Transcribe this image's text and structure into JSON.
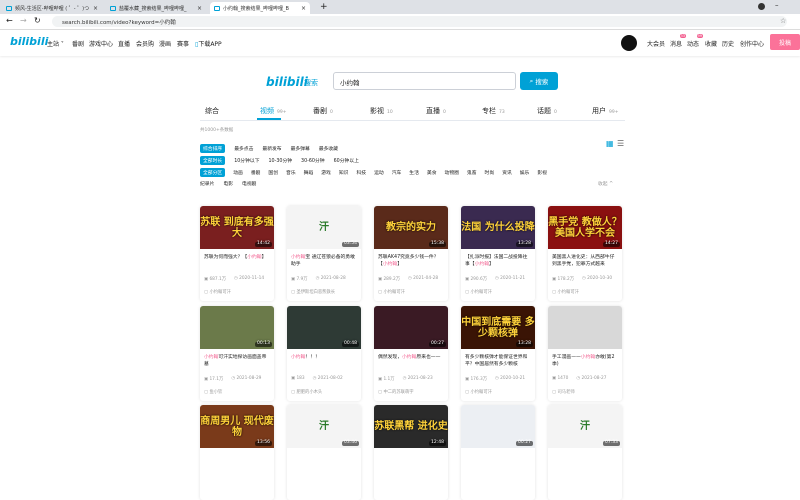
{
  "browser": {
    "tabs": [
      {
        "title": "频风-生活区-哔哩哔哩 ( ゜- ゜)つ"
      },
      {
        "title": "盐覆水藏_搜索结果_哔哩哔哩_"
      },
      {
        "title": "小约翰_搜索结果_哔哩哔哩_B"
      }
    ],
    "new_tab": "+",
    "url": "search.bilibili.com/video?keyword=小约翰"
  },
  "nav": {
    "logo": "bilibili",
    "items": [
      "主站",
      "番剧",
      "游戏中心",
      "直播",
      "会员购",
      "漫画",
      "赛事",
      "下载APP"
    ],
    "right": [
      "大会员",
      "消息",
      "动态",
      "收藏",
      "历史",
      "创作中心"
    ],
    "badges": {
      "messages": "33",
      "dynamic": "99"
    },
    "upload": "投稿"
  },
  "search": {
    "logo": "bilibili",
    "logo_suffix": "搜索",
    "query": "小约翰",
    "button": "搜索"
  },
  "tabs": [
    {
      "label": "综合",
      "count": ""
    },
    {
      "label": "视频",
      "count": "99+"
    },
    {
      "label": "番剧",
      "count": "0"
    },
    {
      "label": "影视",
      "count": "10"
    },
    {
      "label": "直播",
      "count": "0"
    },
    {
      "label": "专栏",
      "count": "73"
    },
    {
      "label": "话题",
      "count": "0"
    },
    {
      "label": "用户",
      "count": "99+"
    }
  ],
  "result_count": "共1000+条数据",
  "filters": {
    "order": [
      "综合排序",
      "最多点击",
      "最新发布",
      "最多弹幕",
      "最多收藏"
    ],
    "duration": [
      "全部时长",
      "10分钟以下",
      "10-30分钟",
      "30-60分钟",
      "60分钟以上"
    ],
    "zones": [
      "全部分区",
      "动画",
      "番剧",
      "国创",
      "音乐",
      "舞蹈",
      "游戏",
      "知识",
      "科技",
      "运动",
      "汽车",
      "生活",
      "美食",
      "动物圈",
      "鬼畜",
      "时尚",
      "资讯",
      "娱乐",
      "影视"
    ],
    "zones2": [
      "纪录片",
      "电影",
      "电视剧"
    ],
    "collapse": "收起 ^"
  },
  "videos": [
    {
      "thumb": "苏联 到底有多强大",
      "duration": "14:42",
      "title_pre": "苏联为何而强大？【",
      "title_hl": "小约翰",
      "title_post": "】",
      "views": "687.1万",
      "date": "2020-11-14",
      "up": "小约翰可汗",
      "bg": "#7a1f1f"
    },
    {
      "thumb": "汗",
      "duration": "03:54",
      "title_pre": "",
      "title_hl": "小约翰",
      "title_post": "宝 通辽苍狼必备的勇敢助手",
      "views": "7.9万",
      "date": "2021-08-28",
      "up": "圣伊斯坦白恶熊鉄长",
      "bg": "#f4f4f4"
    },
    {
      "thumb": "教宗的实力",
      "duration": "15:38",
      "title_pre": "苏联AK47究竟多少钱一件？【",
      "title_hl": "小约翰",
      "title_post": "】",
      "views": "289.2万",
      "date": "2021-04-28",
      "up": "小约翰可汗",
      "bg": "#5a2a1a"
    },
    {
      "thumb": "法国 为什么投降",
      "duration": "13:28",
      "title_pre": "【扎派时报】法国二战投降往事【",
      "title_hl": "小约翰",
      "title_post": "】",
      "views": "290.6万",
      "date": "2020-11-21",
      "up": "小约翰可汗",
      "bg": "#3a2a50"
    },
    {
      "thumb": "黑手党 教做人？美国人学不会",
      "duration": "14:27",
      "title_pre": "美国黑人进化史：从西部牛仔到黑手党，犯罪方式越来",
      "title_hl": "",
      "title_post": "",
      "views": "178.2万",
      "date": "2020-10-30",
      "up": "小约翰可汗",
      "bg": "#8a1010"
    },
    {
      "thumb": "",
      "duration": "00:13",
      "title_pre": "",
      "title_hl": "小约翰",
      "title_post": "可汗实地探访画面盖帝墓",
      "views": "17.1万",
      "date": "2021-08-29",
      "up": "鱼小钦",
      "bg": "#6b7a4a"
    },
    {
      "thumb": "",
      "duration": "00:48",
      "title_pre": "",
      "title_hl": "小约翰",
      "title_post": "！！！",
      "views": "183",
      "date": "2021-08-02",
      "up": "肥肥的小木头",
      "bg": "#2e3a35"
    },
    {
      "thumb": "",
      "duration": "00:27",
      "title_pre": "偶然发现，",
      "title_hl": "小约翰",
      "title_post": "原来也——",
      "views": "1.1万",
      "date": "2021-08-23",
      "up": "中二的苏联萌宇",
      "bg": "#3a1a24"
    },
    {
      "thumb": "中国到底需要 多少颗核弹",
      "duration": "13:28",
      "title_pre": "有多少颗核弹才能保证世界和平？中国居然有多少颗核",
      "title_hl": "",
      "title_post": "",
      "views": "176.3万",
      "date": "2020-10-21",
      "up": "小约翰可汗",
      "bg": "#3a1405"
    },
    {
      "thumb": "",
      "duration": "",
      "title_pre": "手工漫画——",
      "title_hl": "小约翰",
      "title_post": "亦敢(第2季)",
      "views": "1470",
      "date": "2021-08-27",
      "up": "司马老师",
      "bg": "#d8d8d8"
    },
    {
      "thumb": "商周男儿 现代废物",
      "duration": "13:56",
      "bg": "#7a3a1a"
    },
    {
      "thumb": "汗",
      "duration": "03:46",
      "bg": "#f4f4f4"
    },
    {
      "thumb": "苏联黑帮 进化史",
      "duration": "12:48",
      "bg": "#2a2a2a"
    },
    {
      "thumb": "",
      "duration": "00:27",
      "bg": "#eceff3"
    },
    {
      "thumb": "汗",
      "duration": "07:33",
      "bg": "#f4f4f4"
    }
  ]
}
